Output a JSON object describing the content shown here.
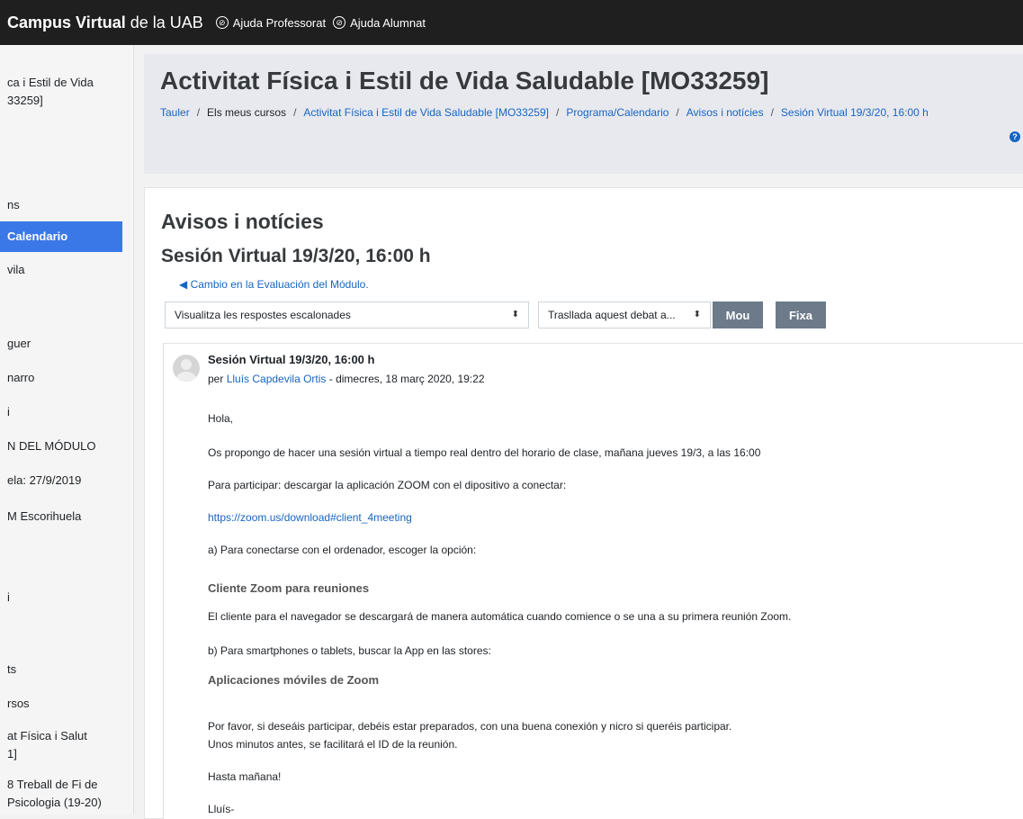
{
  "topbar": {
    "brand_bold": "Campus Virtual",
    "brand_rest": " de la UAB",
    "help_prof": "Ajuda Professorat",
    "help_alum": "Ajuda Alumnat"
  },
  "sidebar": {
    "items": [
      {
        "label": "ca i Estil de Vida"
      },
      {
        "label": "33259]"
      },
      {
        "label": "ns"
      },
      {
        "label": "Calendario"
      },
      {
        "label": "vila"
      },
      {
        "label": "guer"
      },
      {
        "label": "narro"
      },
      {
        "label": "i"
      },
      {
        "label": "N DEL MÓDULO"
      },
      {
        "label": "ela: 27/9/2019"
      },
      {
        "label": "M Escorihuela"
      },
      {
        "label": "i"
      },
      {
        "label": "ts"
      },
      {
        "label": "rsos"
      },
      {
        "label": "at Física i Salut"
      },
      {
        "label": "1]"
      },
      {
        "label": "8 Treball de Fi de"
      },
      {
        "label": "Psicologia (19-20)"
      }
    ]
  },
  "header": {
    "title": "Activitat Física i Estil de Vida Saludable [MO33259]",
    "breadcrumb": [
      {
        "label": "Tauler"
      },
      {
        "label": "Els meus cursos"
      },
      {
        "label": "Activitat Física i Estil de Vida Saludable [MO33259]"
      },
      {
        "label": "Programa/Calendario"
      },
      {
        "label": "Avisos i notícies"
      },
      {
        "label": "Sesión Virtual 19/3/20, 16:00 h"
      }
    ],
    "separator": "/"
  },
  "main": {
    "forum_title": "Avisos i notícies",
    "discussion_title": "Sesión Virtual 19/3/20, 16:00 h",
    "prev_link": "◀ Cambio en la Evaluación del Módulo.",
    "display_select": "Visualitza les respostes escalonades",
    "move_select": "Trasllada aquest debat a...",
    "move_button": "Mou",
    "pin_button": "Fixa"
  },
  "post": {
    "subject": "Sesión Virtual 19/3/20, 16:00 h",
    "by": "per",
    "author": "Lluís Capdevila Ortis",
    "date": " - dimecres, 18 març 2020, 19:22",
    "body": {
      "p1": "Hola,",
      "p2": "Os propongo de hacer una sesión virtual a tiempo real dentro del horario de clase, mañana jueves 19/3, a las 16:00",
      "p3": "Para participar: descargar la aplicación ZOOM con el dipositivo a conectar:",
      "link": "https://zoom.us/download#client_4meeting",
      "p4": "a) Para conectarse con el ordenador, escoger la opción:",
      "h1": "Cliente Zoom para reuniones",
      "p5": "El cliente para el navegador se descargará de manera automática cuando comience o se una a su primera reunión Zoom.",
      "p6": "b) Para smartphones o tablets, buscar la App en las stores:",
      "h2": "Aplicaciones móviles de Zoom",
      "p7": "Por favor, si deseáis participar, debéis estar preparados, con una buena conexión y nicro si queréis participar.",
      "p8": "Unos minutos antes, se facilitará el ID de la reunión.",
      "p9": "Hasta mañana!",
      "p10": "Lluís-"
    }
  }
}
